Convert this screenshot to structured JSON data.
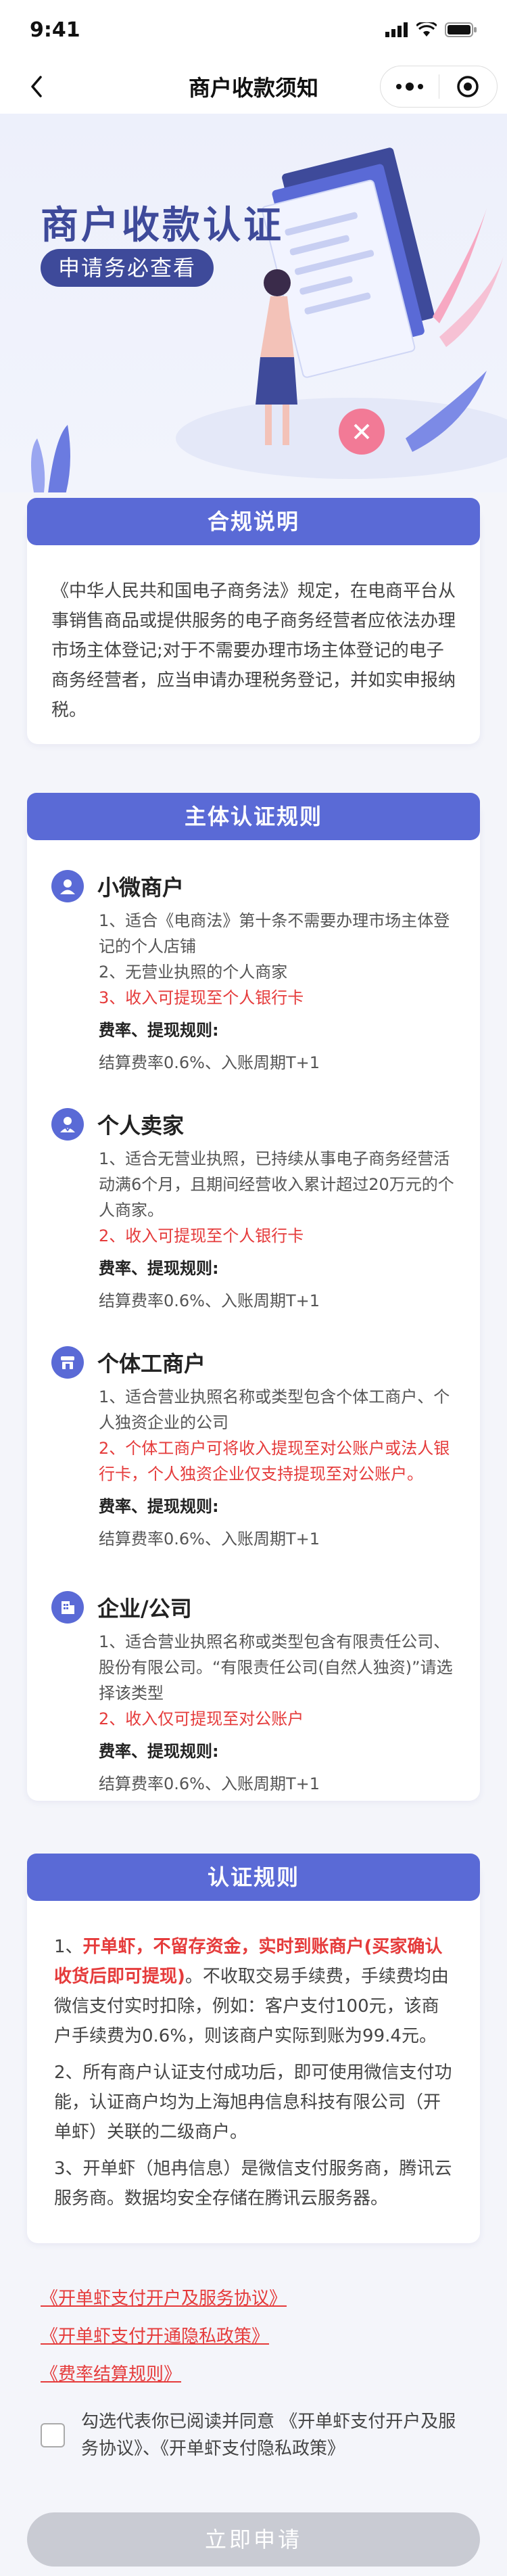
{
  "status": {
    "time": "9:41"
  },
  "nav": {
    "title": "商户收款须知"
  },
  "hero": {
    "title": "商户收款认证",
    "badge": "申请务必查看"
  },
  "compliance": {
    "header": "合规说明",
    "text": "《中华人民共和国电子商务法》规定，在电商平台从事销售商品或提供服务的电子商务经营者应依法办理市场主体登记;对于不需要办理市场主体登记的电子商务经营者，应当申请办理税务登记，并如实申报纳税。"
  },
  "subject": {
    "header": "主体认证规则",
    "entities": [
      {
        "name": "小微商户",
        "lines": [
          "1、适合《电商法》第十条不需要办理市场主体登记的个人店铺",
          "2、无营业执照的个人商家"
        ],
        "red": "3、收入可提现至个人银行卡",
        "fee_label": "费率、提现规则:",
        "fee_value": "结算费率0.6%、入账周期T+1"
      },
      {
        "name": "个人卖家",
        "lines": [
          "1、适合无营业执照，已持续从事电子商务经营活动满6个月，且期间经营收入累计超过20万元的个人商家。"
        ],
        "red": "2、收入可提现至个人银行卡",
        "fee_label": "费率、提现规则:",
        "fee_value": "结算费率0.6%、入账周期T+1"
      },
      {
        "name": "个体工商户",
        "lines": [
          "1、适合营业执照名称或类型包含个体工商户、个人独资企业的公司"
        ],
        "red": "2、个体工商户可将收入提现至对公账户或法人银行卡，个人独资企业仅支持提现至对公账户。",
        "fee_label": "费率、提现规则:",
        "fee_value": "结算费率0.6%、入账周期T+1"
      },
      {
        "name": "企业/公司",
        "lines": [
          "1、适合营业执照名称或类型包含有限责任公司、股份有限公司。“有限责任公司(自然人独资)”请选择该类型"
        ],
        "red": "2、收入仅可提现至对公账户",
        "fee_label": "费率、提现规则:",
        "fee_value": "结算费率0.6%、入账周期T+1"
      }
    ]
  },
  "auth": {
    "header": "认证规则",
    "p1_prefix": "1、",
    "p1_red": "开单虾，不留存资金，实时到账商户(买家确认收货后即可提现)",
    "p1_rest": "。不收取交易手续费，手续费均由微信支付实时扣除，例如：客户支付100元，该商户手续费为0.6%，则该商户实际到账为99.4元。",
    "p2": "2、所有商户认证支付成功后，即可使用微信支付功能，认证商户均为上海旭冉信息科技有限公司（开单虾）关联的二级商户。",
    "p3": "3、开单虾（旭冉信息）是微信支付服务商，腾讯云服务商。数据均安全存储在腾讯云服务器。"
  },
  "links": [
    "《开单虾支付开户及服务协议》",
    "《开单虾支付开通隐私政策》",
    "《费率结算规则》"
  ],
  "agree": {
    "text": "勾选代表你已阅读并同意 《开单虾支付开户及服务协议》、《开单虾支付隐私政策》"
  },
  "submit": {
    "label": "立即申请"
  },
  "colors": {
    "primary": "#5a6ad6",
    "dark": "#3e4a9a",
    "red": "#e53b3b",
    "disabled": "#c9cbd3"
  }
}
